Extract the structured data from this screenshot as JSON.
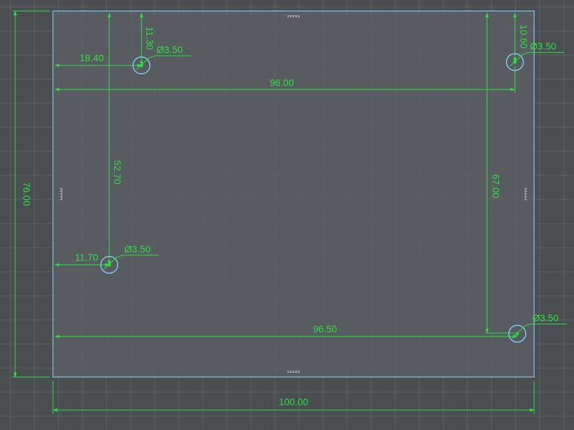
{
  "drawing": {
    "units": "mm",
    "board": {
      "width": 100.0,
      "height": 76.0
    },
    "holes": [
      {
        "id": "top-left",
        "x": 18.4,
        "y": 11.3,
        "diameter": 3.5
      },
      {
        "id": "top-right",
        "x": 96.0,
        "y": 10.6,
        "diameter": 3.5
      },
      {
        "id": "bottom-left",
        "x": 11.7,
        "y": 52.7,
        "diameter": 3.5
      },
      {
        "id": "bottom-right",
        "x": 96.5,
        "y": 67.0,
        "diameter": 3.5
      }
    ],
    "dimension_labels": {
      "overall_width": "100.00",
      "overall_height": "76.00",
      "hole_tl_x": "18.40",
      "hole_tl_y": "11.30",
      "hole_tl_dia": "Ø3.50",
      "hole_tr_x": "96.00",
      "hole_tr_y": "10.60",
      "hole_tr_dia": "Ø3.50",
      "hole_bl_x": "11.70",
      "hole_bl_y": "52.70",
      "hole_bl_dia": "Ø3.50",
      "hole_br_x": "96.50",
      "hole_br_y": "67.00",
      "hole_br_dia": "Ø3.50"
    },
    "colors": {
      "background": "#4b4e50",
      "grid": "#5e6163",
      "board_fill": "#5a5f63",
      "board_outline": "#7ec8e8",
      "dimension": "#27e23c",
      "hole": "#7ec8e8"
    }
  }
}
